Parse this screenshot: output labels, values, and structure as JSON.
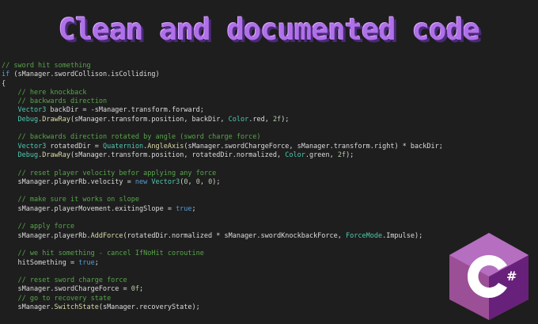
{
  "banner": {
    "title": "Clean and documented code",
    "title_color": "#b070e8"
  },
  "code_lines": [
    "// sword hit something",
    "if (sManager.swordCollison.isColliding)",
    "{",
    "    // here knockback",
    "    // backwards direction",
    "    Vector3 backDir = -sManager.transform.forward;",
    "    Debug.DrawRay(sManager.transform.position, backDir, Color.red, 2f);",
    "",
    "    // backwards direction rotated by angle (sword charge force)",
    "    Vector3 rotatedDir = Quaternion.AngleAxis(sManager.swordChargeForce, sManager.transform.right) * backDir;",
    "    Debug.DrawRay(sManager.transform.position, rotatedDir.normalized, Color.green, 2f);",
    "",
    "    // reset player velocity befor applying any force",
    "    sManager.playerRb.velocity = new Vector3(0, 0, 0);",
    "",
    "    // make sure it works on slope",
    "    sManager.playerMovement.exitingSlope = true;",
    "",
    "    // apply force",
    "    sManager.playerRb.AddForce(rotatedDir.normalized * sManager.swordKnockbackForce, ForceMode.Impulse);",
    "",
    "    // we hit something - cancel IfNoHit coroutine",
    "    hitSomething = true;",
    "",
    "    // reset sword charge force",
    "    sManager.swordChargeForce = 0f;",
    "    // go to recovery state",
    "    sManager.SwitchState(sManager.recoveryState);"
  ],
  "logo": {
    "text": "C#",
    "icon": "csharp-logo-icon",
    "colors": {
      "outer": "#9b4f96",
      "dark": "#68217a",
      "light": "#b56ec0",
      "letter": "#ffffff"
    }
  },
  "syntax_colors": {
    "comment": "#57a64a",
    "keyword": "#569cd6",
    "type": "#4ec9b0",
    "method": "#dcdcaa",
    "number": "#b5cea8",
    "text": "#dcdcdc",
    "background": "#1e1e1e"
  }
}
